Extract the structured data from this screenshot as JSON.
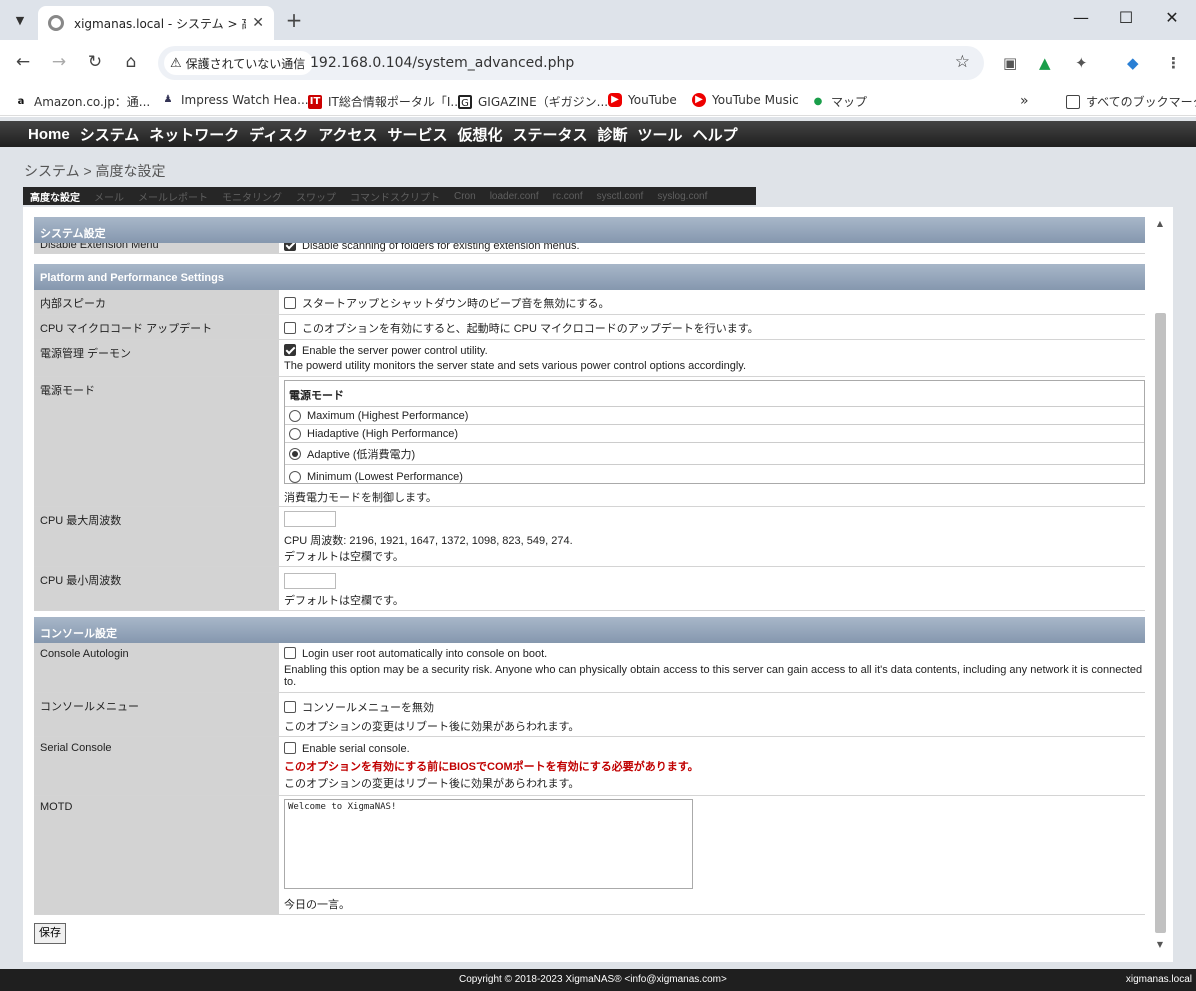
{
  "browser": {
    "tab_title": "xigmanas.local - システム > 高度",
    "address_security": "保護されていない通信",
    "url": "192.168.0.104/system_advanced.php",
    "bookmarks": [
      {
        "label": "Amazon.co.jp：通..."
      },
      {
        "label": "Impress Watch Hea..."
      },
      {
        "label": "IT総合情報ポータル「I..."
      },
      {
        "label": "GIGAZINE（ギガジン..."
      },
      {
        "label": "YouTube"
      },
      {
        "label": "YouTube Music"
      },
      {
        "label": "マップ"
      }
    ],
    "all_bookmarks": "すべてのブックマーク"
  },
  "nav": {
    "items": [
      "Home",
      "システム",
      "ネットワーク",
      "ディスク",
      "アクセス",
      "サービス",
      "仮想化",
      "ステータス",
      "診断",
      "ツール",
      "ヘルプ"
    ]
  },
  "page": {
    "title": "システム > 高度な設定",
    "subtabs": [
      "高度な設定",
      "メール",
      "メールレポート",
      "モニタリング",
      "スワップ",
      "コマンドスクリプト",
      "Cron",
      "loader.conf",
      "rc.conf",
      "sysctl.conf",
      "syslog.conf"
    ]
  },
  "sections": {
    "system": "システム設定",
    "platform": "Platform and Performance Settings",
    "console": "コンソール設定"
  },
  "rows": {
    "ext_menu": {
      "label": "Disable Extension Menu",
      "text": "Disable scanning of folders for existing extension menus."
    },
    "speaker": {
      "label": "内部スピーカ",
      "text": "スタートアップとシャットダウン時のビープ音を無効にする。"
    },
    "microcode": {
      "label": "CPU マイクロコード アップデート",
      "text": "このオプションを有効にすると、起動時に CPU マイクロコードのアップデートを行います。"
    },
    "powerd": {
      "label": "電源管理 デーモン",
      "text": "Enable the server power control utility.",
      "desc": "The powerd utility monitors the server state and sets various power control options accordingly."
    },
    "powermode": {
      "label": "電源モード",
      "box_title": "電源モード",
      "options": [
        "Maximum (Highest Performance)",
        "Hiadaptive (High Performance)",
        "Adaptive (低消費電力)",
        "Minimum (Lowest Performance)"
      ],
      "desc": "消費電力モードを制御します。"
    },
    "cpumax": {
      "label": "CPU 最大周波数",
      "freq": "CPU 周波数: 2196, 1921, 1647, 1372, 1098, 823, 549, 274.",
      "desc": "デフォルトは空欄です。"
    },
    "cpumin": {
      "label": "CPU 最小周波数",
      "desc": "デフォルトは空欄です。"
    },
    "autologin": {
      "label": "Console Autologin",
      "text": "Login user root automatically into console on boot.",
      "desc1": "Enabling this option may be a security risk. Anyone who can physically obtain access to this server can gain access to all it's data contents, including any network it is connected",
      "desc2": "to."
    },
    "consolemenu": {
      "label": "コンソールメニュー",
      "text": "コンソールメニューを無効",
      "desc": "このオプションの変更はリブート後に効果があらわれます。"
    },
    "serial": {
      "label": "Serial Console",
      "text": "Enable serial console.",
      "warn": "このオプションを有効にする前にBIOSでCOMポートを有効にする必要があります。",
      "desc": "このオプションの変更はリブート後に効果があらわれます。"
    },
    "motd": {
      "label": "MOTD",
      "value": "Welcome to XigmaNAS!",
      "desc": "今日の一言。"
    }
  },
  "save_label": "保存",
  "footer": {
    "copyright": "Copyright © 2018-2023 XigmaNAS® <info@xigmanas.com>",
    "host": "xigmanas.local"
  }
}
